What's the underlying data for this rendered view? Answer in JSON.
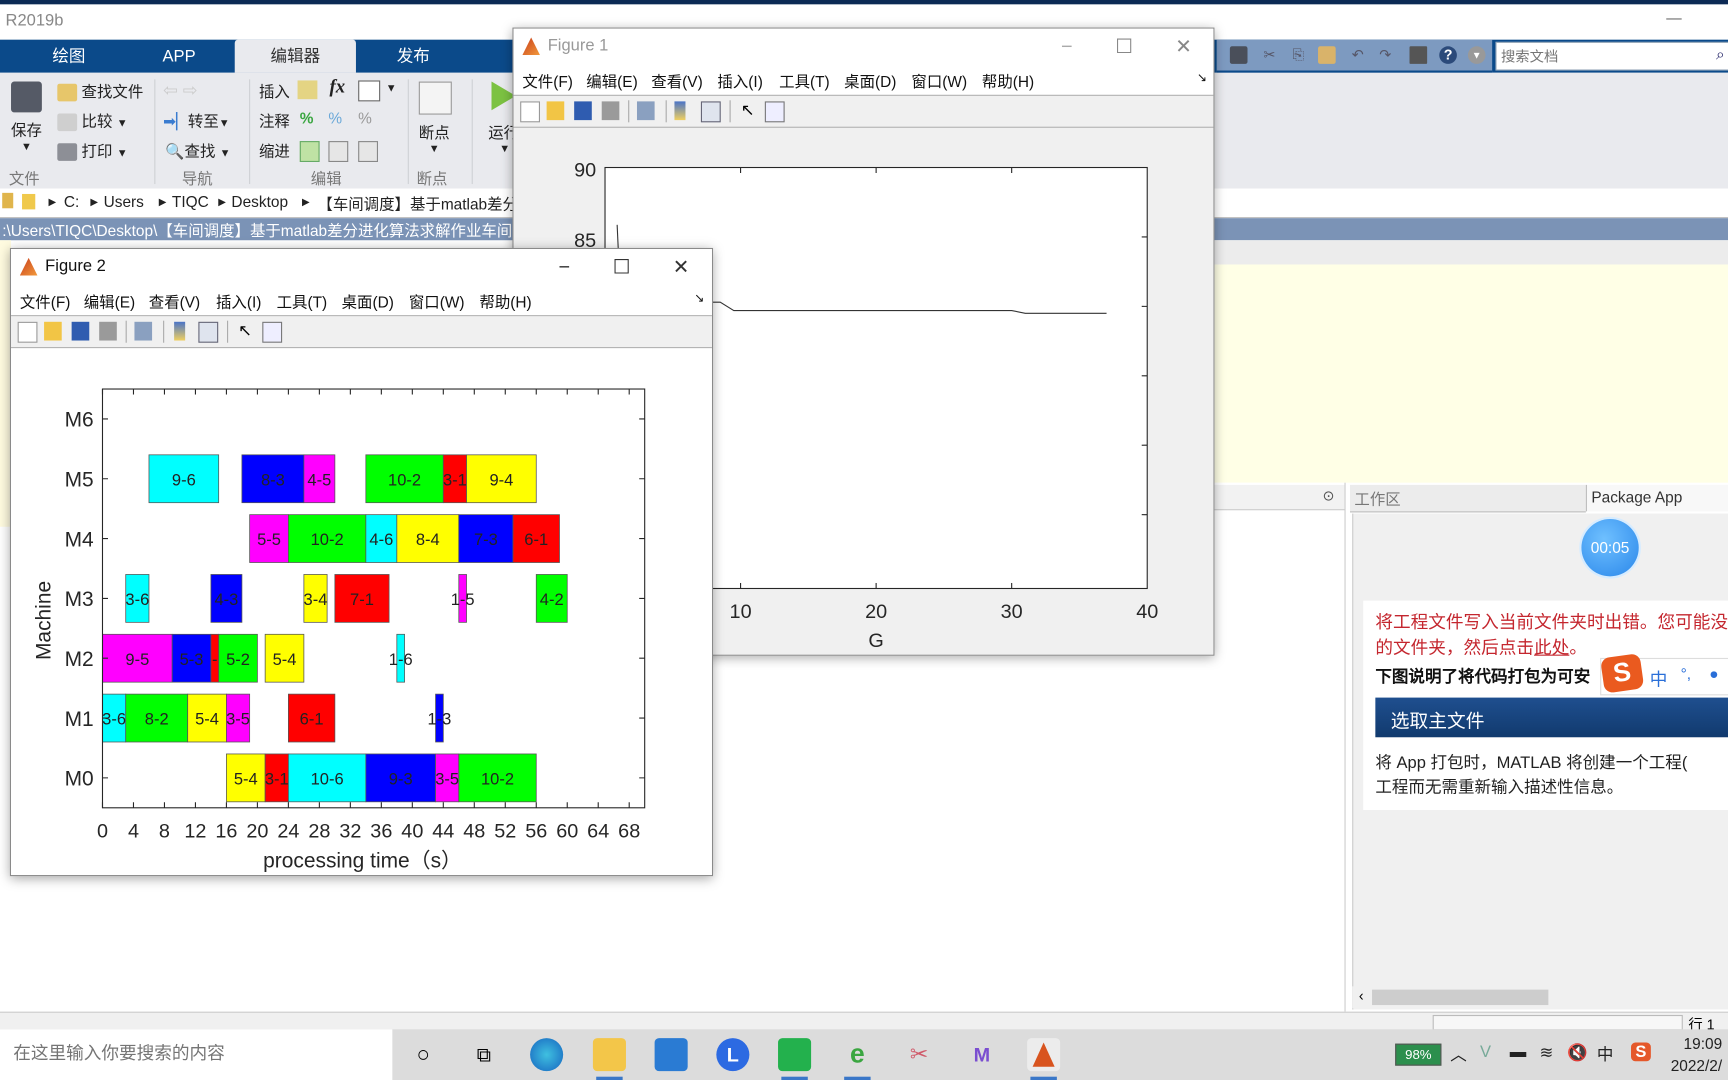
{
  "app": {
    "title": "R2019b",
    "minimize_glyph": "—",
    "tabs": [
      {
        "label": "绘图",
        "active": false
      },
      {
        "label": "APP",
        "active": false
      },
      {
        "label": "编辑器",
        "active": true
      },
      {
        "label": "发布",
        "active": false
      }
    ],
    "quick_access_icons": [
      "save-icon",
      "cut-icon",
      "copy-icon",
      "paste-icon",
      "undo-icon",
      "redo-icon",
      "switch-windows-icon",
      "help-icon",
      "expand-icon"
    ],
    "doc_search": {
      "placeholder": "搜索文档",
      "value": ""
    }
  },
  "ribbon": {
    "file_group": {
      "save": "保存",
      "find_files": "查找文件",
      "compare": "比较",
      "print": "打印",
      "group_label": "文件"
    },
    "nav_group": {
      "goto": "转至",
      "find": "查找",
      "group_label": "导航"
    },
    "edit_group": {
      "insert": "插入",
      "comment": "注释",
      "indent": "缩进",
      "fx": "fx",
      "percent": "%",
      "group_label": "编辑"
    },
    "breakpoint_group": {
      "breakpoints": "断点",
      "group_label": "断点"
    },
    "run_group": {
      "run": "运行"
    }
  },
  "path": {
    "crumbs": [
      "C:",
      "Users",
      "TIQC",
      "Desktop",
      "【车间调度】基于matlab差分"
    ],
    "current_folder": ":\\Users\\TIQC\\Desktop\\【车间调度】基于matlab差分进化算法求解作业车间"
  },
  "figure1": {
    "title": "Figure 1",
    "menu": [
      "文件(F)",
      "编辑(E)",
      "查看(V)",
      "插入(I)",
      "工具(T)",
      "桌面(D)",
      "窗口(W)",
      "帮助(H)"
    ],
    "toolbar_icons": [
      "new-figure-icon",
      "open-icon",
      "save-icon",
      "print-icon",
      "link-icon",
      "colorbar-icon",
      "legend-icon",
      "pointer-icon",
      "property-editor-icon"
    ],
    "chart": {
      "type": "line",
      "xlabel": "G",
      "yticks_visible": [
        "90",
        "85"
      ],
      "xticks_visible": [
        "10",
        "20",
        "30",
        "40"
      ],
      "xlim": [
        0,
        40
      ],
      "ylim_top": 90,
      "series_visible_fragment": [
        [
          7,
          80.3
        ],
        [
          8.5,
          80.3
        ],
        [
          9.5,
          79.7
        ],
        [
          30,
          79.7
        ],
        [
          31,
          79.5
        ],
        [
          37,
          79.5
        ]
      ]
    }
  },
  "figure2": {
    "title": "Figure 2",
    "menu": [
      "文件(F)",
      "编辑(E)",
      "查看(V)",
      "插入(I)",
      "工具(T)",
      "桌面(D)",
      "窗口(W)",
      "帮助(H)"
    ],
    "toolbar_icons": [
      "new-figure-icon",
      "open-icon",
      "save-icon",
      "print-icon",
      "link-icon",
      "colorbar-icon",
      "legend-icon",
      "pointer-icon",
      "property-editor-icon"
    ]
  },
  "chart_data": {
    "type": "gantt",
    "title": "",
    "xlabel": "processing time（s）",
    "ylabel": "Machine",
    "xlim": [
      0,
      70
    ],
    "xticks": [
      0,
      4,
      8,
      12,
      16,
      20,
      24,
      28,
      32,
      36,
      40,
      44,
      48,
      52,
      56,
      60,
      64,
      68
    ],
    "machines": [
      "M0",
      "M1",
      "M2",
      "M3",
      "M4",
      "M5",
      "M6"
    ],
    "colors": {
      "cyan": "#00ffff",
      "blue": "#0000ff",
      "magenta": "#ff00ff",
      "green": "#00ff00",
      "red": "#ff0000",
      "yellow": "#ffff00"
    },
    "tasks": [
      {
        "machine": 5,
        "label": "9-6",
        "start": 6,
        "end": 15,
        "color": "cyan"
      },
      {
        "machine": 5,
        "label": "8-3",
        "start": 18,
        "end": 26,
        "color": "blue"
      },
      {
        "machine": 5,
        "label": "4-5",
        "start": 26,
        "end": 30,
        "color": "magenta"
      },
      {
        "machine": 5,
        "label": "10-2",
        "start": 34,
        "end": 44,
        "color": "green"
      },
      {
        "machine": 5,
        "label": "3-1",
        "start": 44,
        "end": 47,
        "color": "red"
      },
      {
        "machine": 5,
        "label": "9-4",
        "start": 47,
        "end": 56,
        "color": "yellow"
      },
      {
        "machine": 4,
        "label": "5-5",
        "start": 19,
        "end": 24,
        "color": "magenta"
      },
      {
        "machine": 4,
        "label": "10-2",
        "start": 24,
        "end": 34,
        "color": "green"
      },
      {
        "machine": 4,
        "label": "4-6",
        "start": 34,
        "end": 38,
        "color": "cyan"
      },
      {
        "machine": 4,
        "label": "8-4",
        "start": 38,
        "end": 46,
        "color": "yellow"
      },
      {
        "machine": 4,
        "label": "7-3",
        "start": 46,
        "end": 53,
        "color": "blue"
      },
      {
        "machine": 4,
        "label": "6-1",
        "start": 53,
        "end": 59,
        "color": "red"
      },
      {
        "machine": 3,
        "label": "3-6",
        "start": 3,
        "end": 6,
        "color": "cyan"
      },
      {
        "machine": 3,
        "label": "4-3",
        "start": 14,
        "end": 18,
        "color": "blue"
      },
      {
        "machine": 3,
        "label": "3-4",
        "start": 26,
        "end": 29,
        "color": "yellow"
      },
      {
        "machine": 3,
        "label": "7-1",
        "start": 30,
        "end": 37,
        "color": "red"
      },
      {
        "machine": 3,
        "label": "1-5",
        "start": 46,
        "end": 47,
        "color": "magenta"
      },
      {
        "machine": 3,
        "label": "4-2",
        "start": 56,
        "end": 60,
        "color": "green"
      },
      {
        "machine": 2,
        "label": "9-5",
        "start": 0,
        "end": 9,
        "color": "magenta"
      },
      {
        "machine": 2,
        "label": "5-3",
        "start": 9,
        "end": 14,
        "color": "blue"
      },
      {
        "machine": 2,
        "label": "-",
        "start": 14,
        "end": 15,
        "color": "red"
      },
      {
        "machine": 2,
        "label": "5-2",
        "start": 15,
        "end": 20,
        "color": "green"
      },
      {
        "machine": 2,
        "label": "5-4",
        "start": 21,
        "end": 26,
        "color": "yellow"
      },
      {
        "machine": 2,
        "label": "1-6",
        "start": 38,
        "end": 39,
        "color": "cyan"
      },
      {
        "machine": 1,
        "label": "3-6",
        "start": 0,
        "end": 3,
        "color": "cyan"
      },
      {
        "machine": 1,
        "label": "8-2",
        "start": 3,
        "end": 11,
        "color": "green"
      },
      {
        "machine": 1,
        "label": "5-4",
        "start": 11,
        "end": 16,
        "color": "yellow"
      },
      {
        "machine": 1,
        "label": "3-5",
        "start": 16,
        "end": 19,
        "color": "magenta"
      },
      {
        "machine": 1,
        "label": "6-1",
        "start": 24,
        "end": 30,
        "color": "red"
      },
      {
        "machine": 1,
        "label": "1-3",
        "start": 43,
        "end": 44,
        "color": "blue"
      },
      {
        "machine": 0,
        "label": "5-4",
        "start": 16,
        "end": 21,
        "color": "yellow"
      },
      {
        "machine": 0,
        "label": "3-1",
        "start": 21,
        "end": 24,
        "color": "red"
      },
      {
        "machine": 0,
        "label": "10-6",
        "start": 24,
        "end": 34,
        "color": "cyan"
      },
      {
        "machine": 0,
        "label": "9-3",
        "start": 34,
        "end": 43,
        "color": "blue"
      },
      {
        "machine": 0,
        "label": "3-5",
        "start": 43,
        "end": 46,
        "color": "magenta"
      },
      {
        "machine": 0,
        "label": "10-2",
        "start": 46,
        "end": 56,
        "color": "green"
      }
    ]
  },
  "panels": {
    "workspace_label": "工作区",
    "package_app_label": "Package App",
    "timer": "00:05",
    "error_text": "将工程文件写入当前文件夹时出错。您可能没",
    "error_text2_prefix": "的文件夹，然后点击",
    "error_link": "此处",
    "error_text2_suffix": "。",
    "bold_text": "下图说明了将代码打包为可安",
    "select_main_file": "选取主文件",
    "desc_line1": "将 App 打包时，MATLAB 将创建一个工程(",
    "desc_line2": "工程而无需重新输入描述性信息。",
    "ime": {
      "mode": "中",
      "punct": "°,",
      "mic": "🎤"
    },
    "status_row_text": "行 1"
  },
  "taskbar": {
    "search_placeholder": "在这里输入你要搜索的内容",
    "apps": [
      "cortana-icon",
      "task-view-icon",
      "edge-icon",
      "file-explorer-icon",
      "mail-icon",
      "l-app-icon",
      "wechat-icon",
      "ie-icon",
      "scissors-app-icon",
      "m-app-icon",
      "matlab-icon"
    ],
    "battery": "98%",
    "ime_indicator": "中",
    "time": "19:09",
    "date": "2022/2/"
  }
}
